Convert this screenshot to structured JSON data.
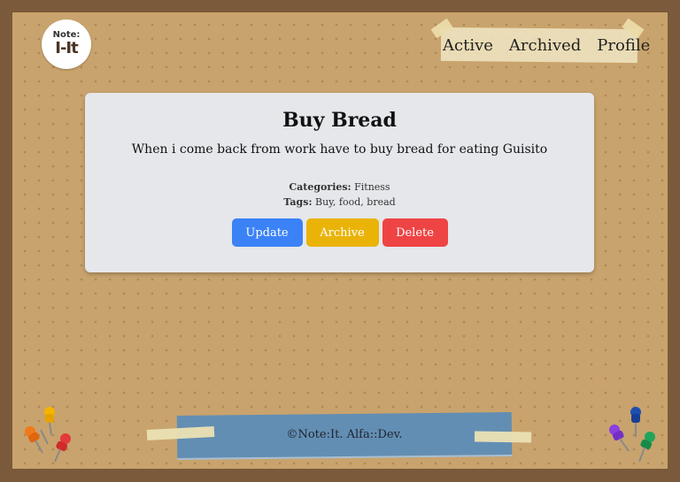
{
  "logo": {
    "top": "Note:",
    "bottom": "I-It"
  },
  "nav": {
    "items": [
      "Active",
      "Archived",
      "Profile"
    ]
  },
  "note": {
    "title": "Buy Bread",
    "description": "When i come back from work have to buy bread for eating Guisito",
    "categories_label": "Categories:",
    "categories": "Fitness",
    "tags_label": "Tags:",
    "tags": "Buy, food, bread"
  },
  "buttons": {
    "update": "Update",
    "archive": "Archive",
    "delete": "Delete"
  },
  "footer": {
    "text": "©Note:It. Alfa::Dev."
  },
  "colors": {
    "update": "#3b82f6",
    "archive": "#eab308",
    "delete": "#ef4444",
    "board": "#c9a36d",
    "frame": "#7a5a3a"
  }
}
